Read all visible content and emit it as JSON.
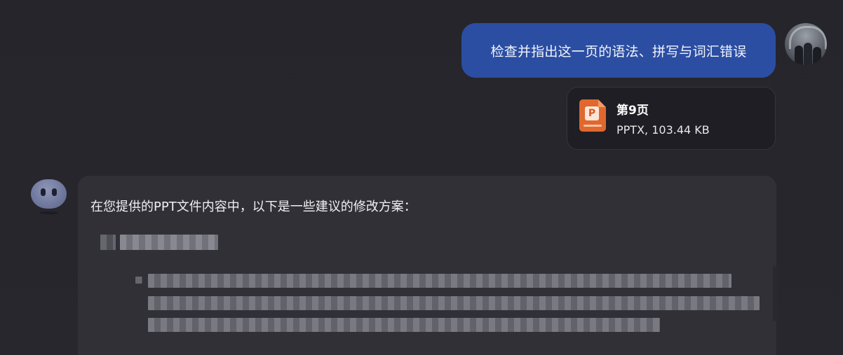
{
  "user_message": {
    "text": "检查并指出这一页的语法、拼写与词汇错误"
  },
  "attachment": {
    "name": "第9页",
    "meta": "PPTX, 103.44 KB",
    "icon": "pptx-file-icon",
    "icon_letter": "P",
    "icon_color": "#e0682e"
  },
  "assistant_message": {
    "intro": "在您提供的PPT文件内容中，以下是一些建议的修改方案："
  },
  "colors": {
    "user_bubble": "#2b4ea2",
    "assistant_bubble": "#303036",
    "background": "#26262c"
  }
}
